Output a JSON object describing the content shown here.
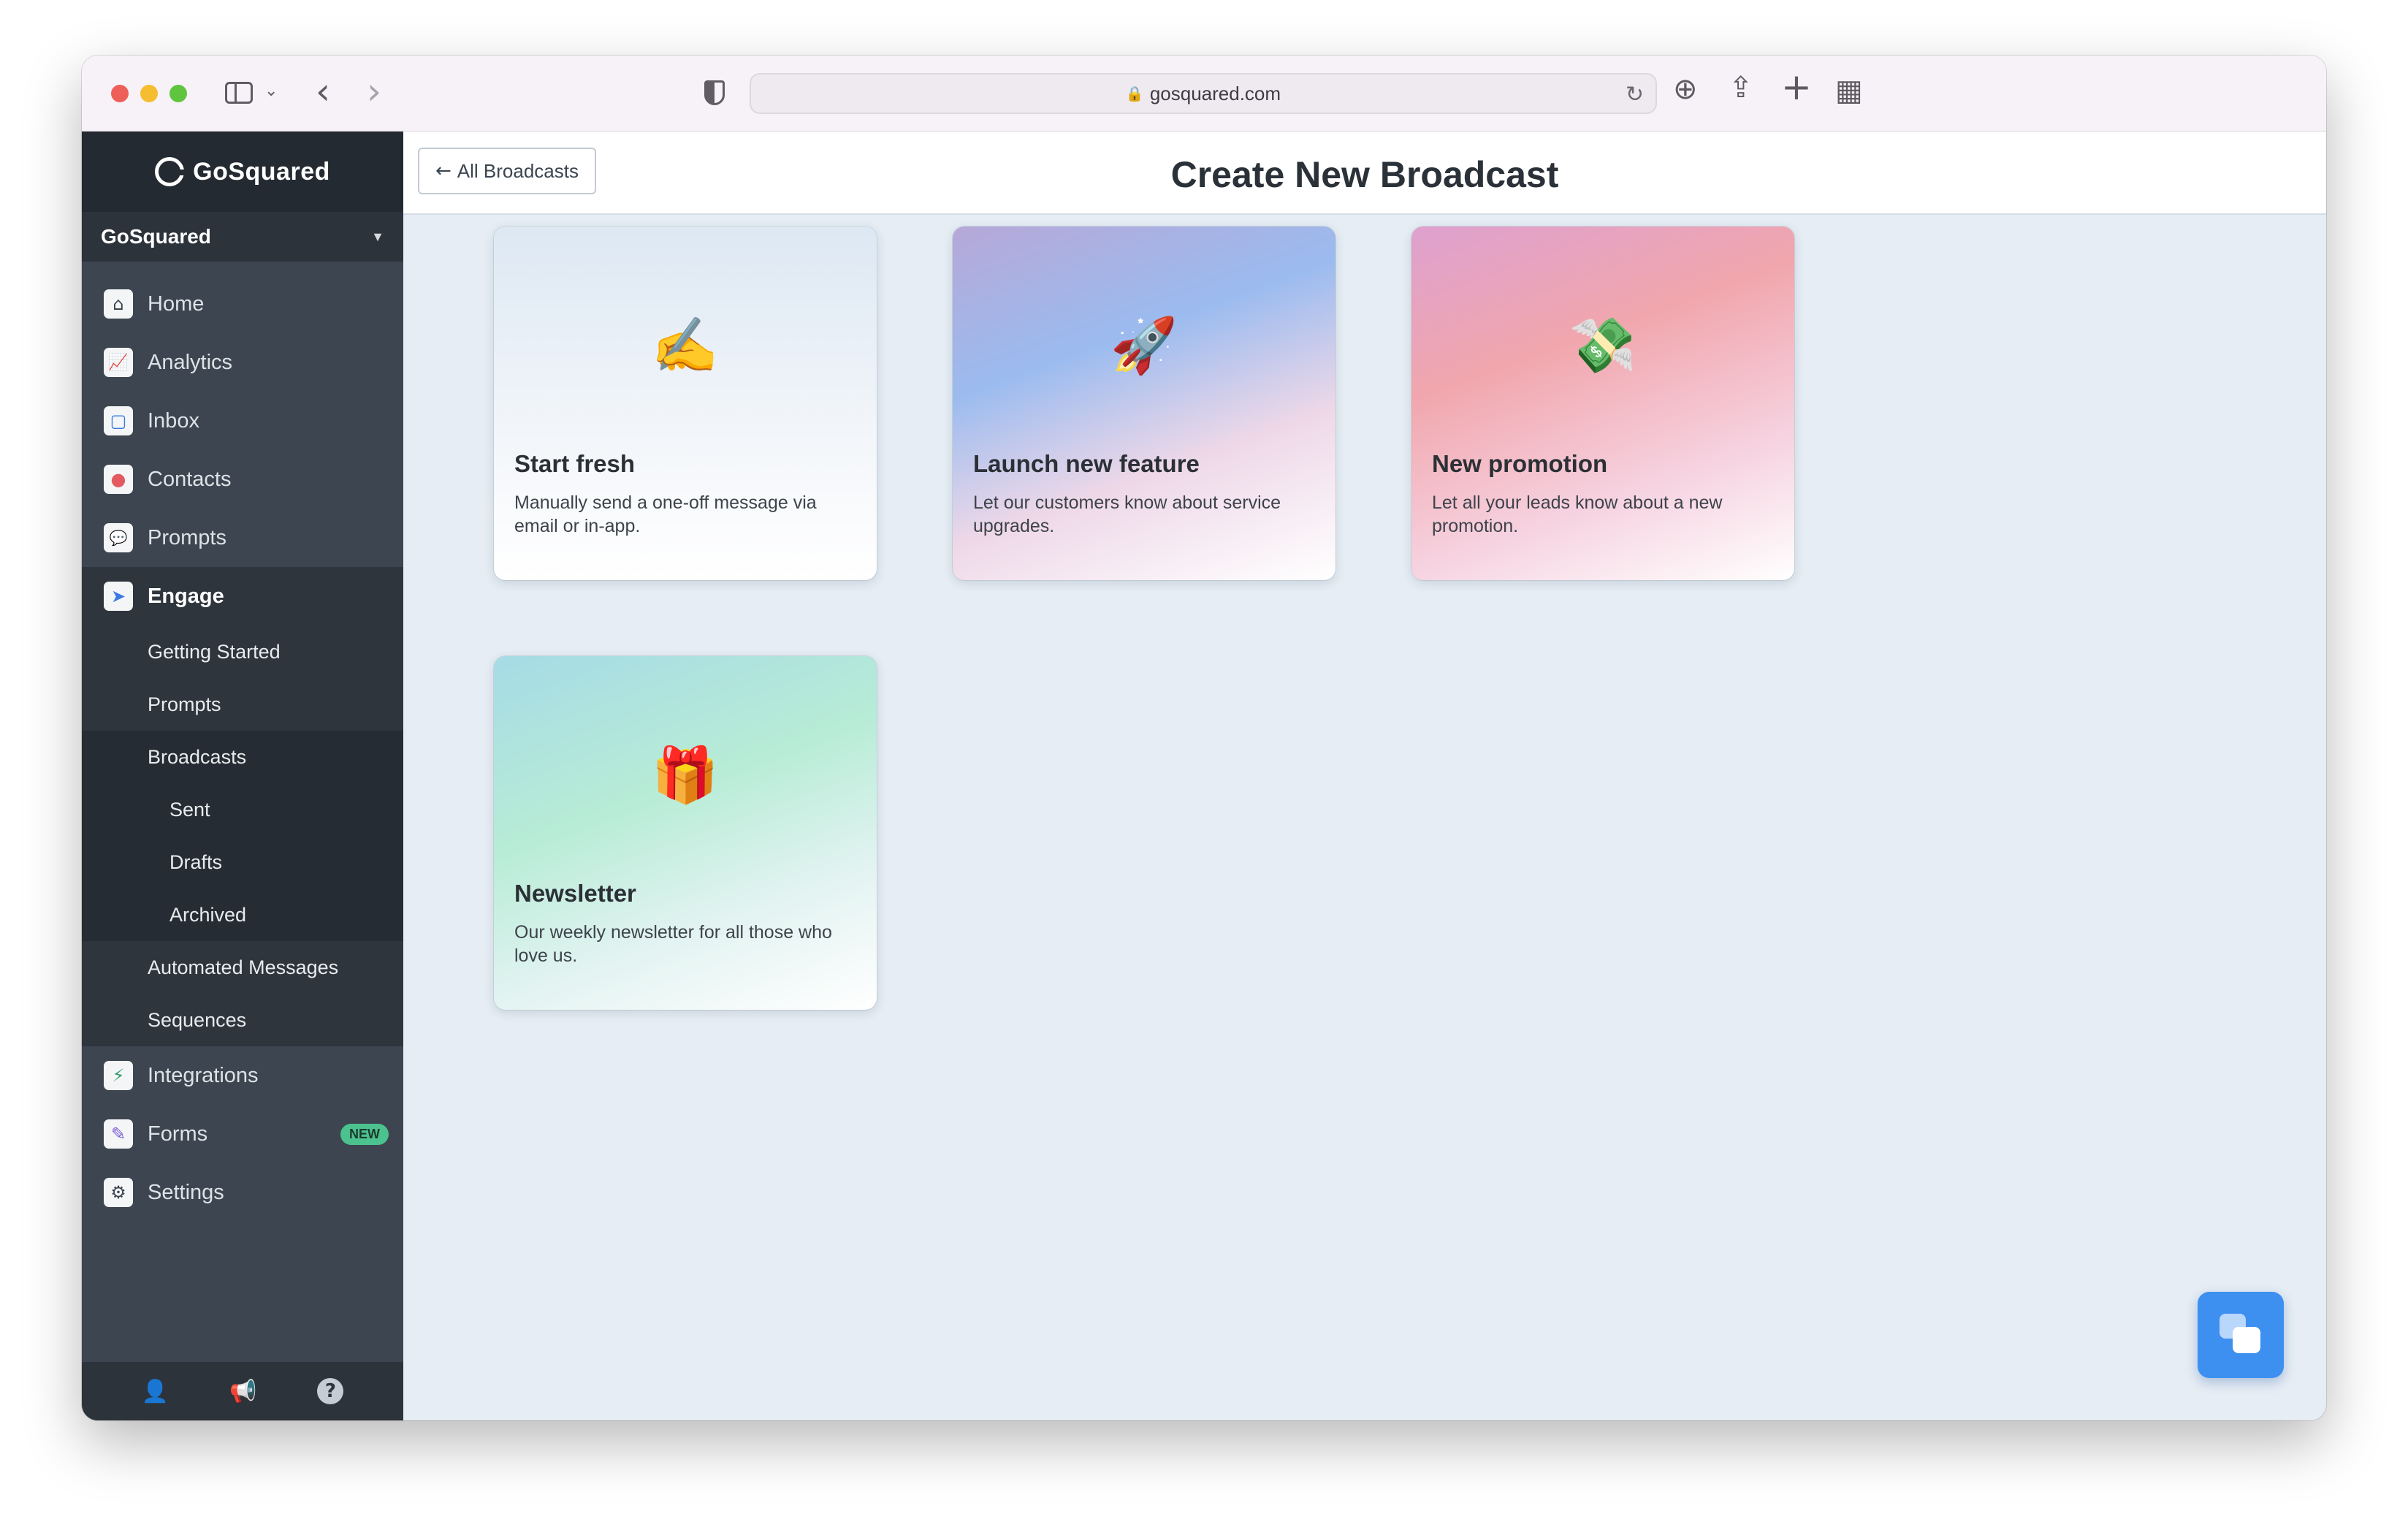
{
  "browser": {
    "url": "gosquared.com",
    "icons": {
      "sidebar": "sidebar-toggle-icon",
      "back": "‹",
      "forward": "›",
      "caret": "⌄",
      "lock": "🔒",
      "reload": "↻",
      "download": "⊕",
      "share": "⇪",
      "new_tab": "+",
      "tabs": "▦"
    }
  },
  "sidebar": {
    "brand": "GoSquared",
    "account": "GoSquared",
    "account_caret": "▼",
    "items": [
      {
        "label": "Home",
        "icon": "⌂"
      },
      {
        "label": "Analytics",
        "icon": "📈"
      },
      {
        "label": "Inbox",
        "icon": "▢"
      },
      {
        "label": "Contacts",
        "icon": "●"
      },
      {
        "label": "Prompts",
        "icon": "💬"
      },
      {
        "label": "Engage",
        "icon": "➤"
      }
    ],
    "engage_sub": [
      "Getting Started",
      "Prompts",
      "Broadcasts",
      "Automated Messages",
      "Sequences"
    ],
    "broadcast_sub": [
      "Sent",
      "Drafts",
      "Archived"
    ],
    "lower_items": [
      {
        "label": "Integrations",
        "icon": "⚡"
      },
      {
        "label": "Forms",
        "icon": "✎",
        "badge": "NEW"
      },
      {
        "label": "Settings",
        "icon": "⚙"
      }
    ],
    "footer_icons": [
      "👤",
      "📢",
      "?"
    ]
  },
  "header": {
    "back_label": "All Broadcasts",
    "back_arrow": "←",
    "title": "Create New Broadcast"
  },
  "cards": [
    {
      "emoji": "✍️",
      "title": "Start fresh",
      "description": "Manually send a one-off message via email or in-app."
    },
    {
      "emoji": "🚀",
      "title": "Launch new feature",
      "description": "Let our customers know about service upgrades."
    },
    {
      "emoji": "💸",
      "title": "New promotion",
      "description": "Let all your leads know about a new promotion."
    },
    {
      "emoji": "🎁",
      "title": "Newsletter",
      "description": "Our weekly newsletter for all those who love us."
    }
  ]
}
